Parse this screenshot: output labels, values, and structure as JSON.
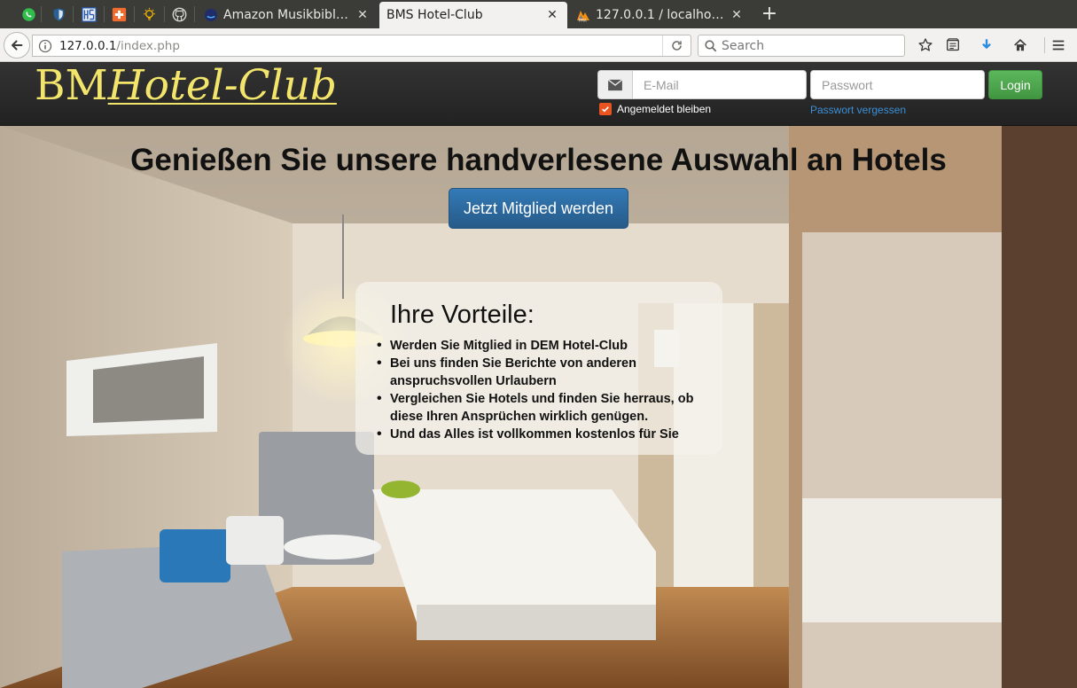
{
  "browser": {
    "pinned_tabs": [
      {
        "name": "whatsapp-icon"
      },
      {
        "name": "shield-icon"
      },
      {
        "name": "hs-grid-icon"
      },
      {
        "name": "swiss-cross-icon"
      },
      {
        "name": "lightbulb-icon"
      },
      {
        "name": "github-icon"
      }
    ],
    "tabs": [
      {
        "title": "Amazon Musikbibli...",
        "icon": "amazon-music-icon",
        "active": false
      },
      {
        "title": "BMS Hotel-Club",
        "icon": "",
        "active": true
      },
      {
        "title": "127.0.0.1 / localhost...",
        "icon": "phpmyadmin-icon",
        "active": false
      }
    ],
    "close_glyph": "✕",
    "newtab_glyph": "+",
    "url_host": "127.0.0.1",
    "url_path": "/index.php",
    "search_placeholder": "Search"
  },
  "header": {
    "brand_plain": "BM",
    "brand_italic": "Hotel-Club",
    "email_placeholder": "E-Mail",
    "password_placeholder": "Passwort",
    "login_label": "Login",
    "remember_label": "Angemeldet bleiben",
    "remember_checked": true,
    "forgot_label": "Passwort vergessen"
  },
  "hero": {
    "title": "Genießen Sie unsere handverlesene Auswahl an Hotels",
    "cta_label": "Jetzt Mitglied werden",
    "benefits_heading": "Ihre Vorteile:",
    "benefits": [
      "Werden Sie Mitglied in DEM Hotel-Club",
      "Bei uns finden Sie Berichte von anderen anspruchsvollen Urlaubern",
      "Vergleichen Sie Hotels und finden Sie herraus, ob diese Ihren Ansprüchen wirklich genügen.",
      "Und das Alles ist vollkommen kostenlos für Sie"
    ]
  },
  "colors": {
    "brand_yellow": "#f3e56c",
    "login_green": "#5cb85c",
    "cta_blue": "#337ab7",
    "checkbox_orange": "#e95420",
    "link_blue": "#3a8fd8"
  }
}
